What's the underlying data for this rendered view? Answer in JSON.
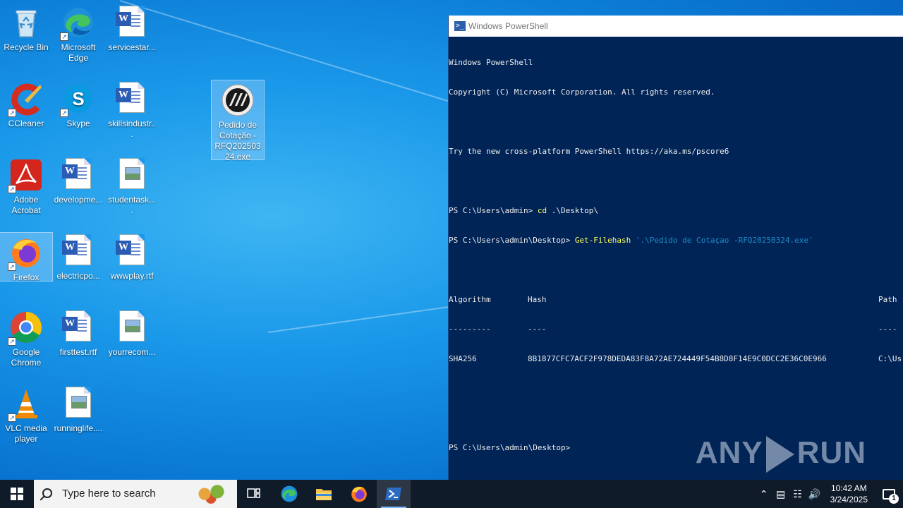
{
  "desktop": {
    "icons": [
      {
        "label": "Recycle Bin",
        "icon": "recycle-bin-icon"
      },
      {
        "label": "Microsoft Edge",
        "icon": "edge-icon"
      },
      {
        "label": "servicestar...",
        "icon": "word-doc-icon"
      },
      {
        "label": "CCleaner",
        "icon": "ccleaner-icon"
      },
      {
        "label": "Skype",
        "icon": "skype-icon"
      },
      {
        "label": "skillsindustr...",
        "icon": "word-doc-icon"
      },
      {
        "label": "Pedido de Cotação -RFQ20250324.exe",
        "icon": "exe-icon"
      },
      {
        "label": "Adobe Acrobat",
        "icon": "acrobat-icon"
      },
      {
        "label": "developme...",
        "icon": "word-doc-icon"
      },
      {
        "label": "studentask....",
        "icon": "image-file-icon"
      },
      {
        "label": "Firefox",
        "icon": "firefox-icon"
      },
      {
        "label": "electricpo...",
        "icon": "word-doc-icon"
      },
      {
        "label": "wwwplay.rtf",
        "icon": "word-doc-icon"
      },
      {
        "label": "Google Chrome",
        "icon": "chrome-icon"
      },
      {
        "label": "firsttest.rtf",
        "icon": "word-doc-icon"
      },
      {
        "label": "yourrecom...",
        "icon": "image-file-icon"
      },
      {
        "label": "VLC media player",
        "icon": "vlc-icon"
      },
      {
        "label": "runninglife....",
        "icon": "image-file-icon"
      }
    ]
  },
  "powershell": {
    "title": "Windows PowerShell",
    "lines": {
      "l1": "Windows PowerShell",
      "l2": "Copyright (C) Microsoft Corporation. All rights reserved.",
      "l3": "Try the new cross-platform PowerShell https://aka.ms/pscore6",
      "prompt1": "PS C:\\Users\\admin> ",
      "cmd1": "cd",
      "arg1": " .\\Desktop\\",
      "prompt2": "PS C:\\Users\\admin\\Desktop> ",
      "cmd2": "Get-Filehash",
      "arg2": " '.\\Pedido de Cotaçao -RFQ20250324.exe'",
      "prompt3": "PS C:\\Users\\admin\\Desktop>"
    },
    "table": {
      "headers": {
        "algorithm": "Algorithm",
        "hash": "Hash",
        "path": "Path"
      },
      "dashes": {
        "algorithm": "---------",
        "hash": "----",
        "path": "----"
      },
      "row": {
        "algorithm": "SHA256",
        "hash": "8B1877CFC7ACF2F978DEDA83F8A72AE724449F54B8D8F14E9C0DCC2E36C0E966",
        "path": "C:\\Us"
      }
    },
    "watermark": {
      "left": "ANY",
      "right": "RUN"
    }
  },
  "taskbar": {
    "search_placeholder": "Type here to search",
    "clock_time": "10:42 AM",
    "clock_date": "3/24/2025",
    "notification_count": "1",
    "apps": [
      "task-view-icon",
      "edge-icon",
      "file-explorer-icon",
      "firefox-icon",
      "powershell-icon"
    ]
  },
  "colors": {
    "ps_background": "#012456",
    "command_yellow": "#ffff60",
    "string_blue": "#1f8ac7",
    "taskbar": "#101b2a"
  }
}
